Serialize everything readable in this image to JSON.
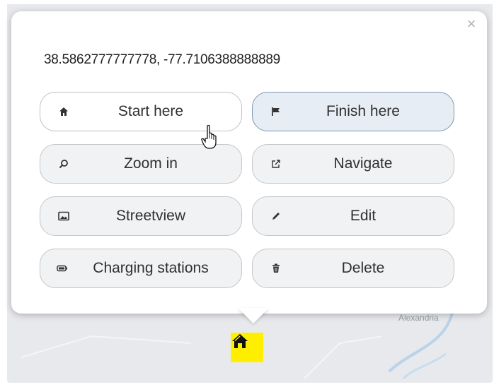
{
  "popup": {
    "coordinates": "38.5862777777778, -77.7106388888889",
    "close_label": "×"
  },
  "buttons": [
    {
      "label": "Start here",
      "icon": "home-icon"
    },
    {
      "label": "Finish here",
      "icon": "flag-icon"
    },
    {
      "label": "Zoom in",
      "icon": "magnifier-icon"
    },
    {
      "label": "Navigate",
      "icon": "external-link-icon"
    },
    {
      "label": "Streetview",
      "icon": "image-icon"
    },
    {
      "label": "Edit",
      "icon": "pencil-icon"
    },
    {
      "label": "Charging stations",
      "icon": "battery-icon"
    },
    {
      "label": "Delete",
      "icon": "trash-icon"
    }
  ],
  "map": {
    "place_label": "Alexandria",
    "marker_color": "#ffee00",
    "marker_icon": "home-icon"
  }
}
